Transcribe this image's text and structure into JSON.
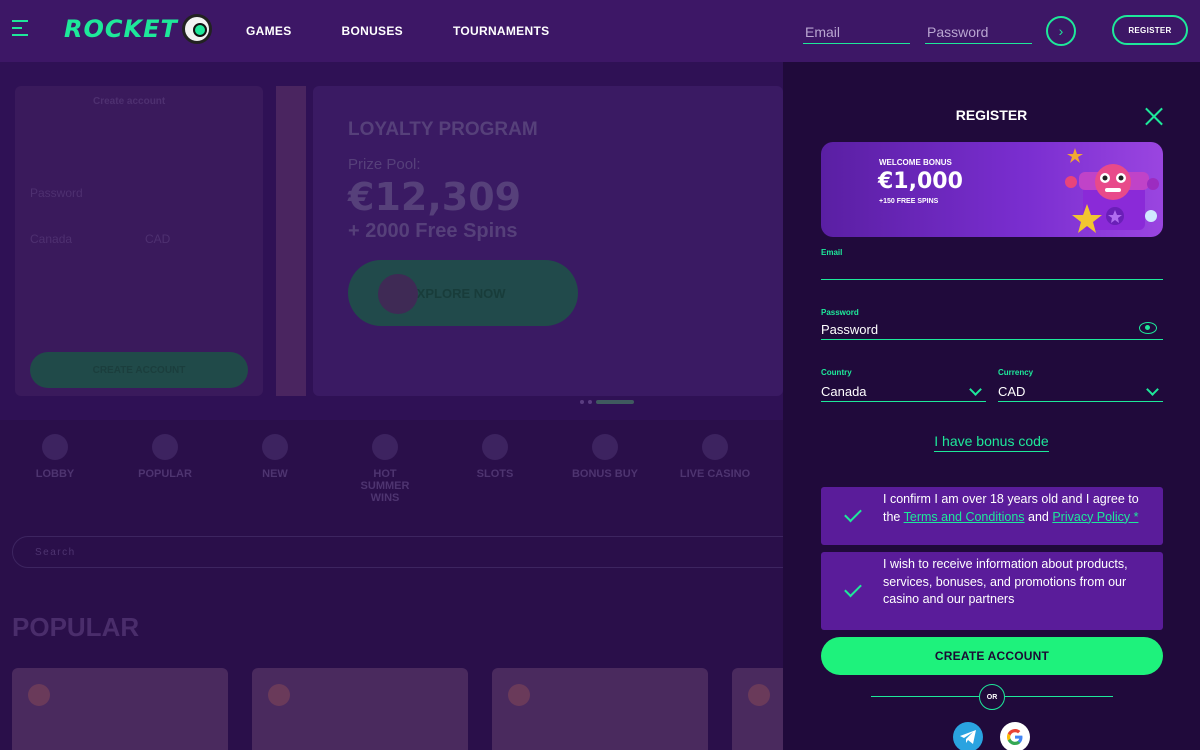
{
  "header": {
    "logo_text": "ROCKET",
    "nav": [
      "GAMES",
      "BONUSES",
      "TOURNAMENTS"
    ],
    "email_placeholder": "Email",
    "password_placeholder": "Password",
    "register_label": "REGISTER"
  },
  "background": {
    "form_title": "Create account",
    "form_password": "Password",
    "form_country": "Canada",
    "form_currency": "CAD",
    "form_button": "CREATE ACCOUNT",
    "loyalty_title": "LOYALTY PROGRAM",
    "prize_label": "Prize Pool:",
    "prize_amount": "€12,309",
    "prize_spins": "+ 2000 Free Spins",
    "explore_label": "EXPLORE NOW",
    "categories": [
      "LOBBY",
      "POPULAR",
      "NEW",
      "HOT SUMMER WINS",
      "SLOTS",
      "BONUS BUY",
      "LIVE CASINO"
    ],
    "search_placeholder": "Search",
    "popular_title": "POPULAR"
  },
  "drawer": {
    "title": "REGISTER",
    "bonus": {
      "label": "WELCOME BONUS",
      "amount": "€1,000",
      "spins": "+150 FREE SPINS"
    },
    "email_label": "Email",
    "email_value": "",
    "password_label": "Password",
    "password_value": "Password",
    "country_label": "Country",
    "country_value": "Canada",
    "currency_label": "Currency",
    "currency_value": "CAD",
    "bonus_code_link": "I have bonus code",
    "confirm_text_1": "I confirm I am over 18 years old and I agree to the ",
    "confirm_link_terms": "Terms and Conditions",
    "confirm_and": " and ",
    "confirm_link_privacy": "Privacy Policy *",
    "marketing_text": "I wish to receive information about products, services, bonuses, and promotions from our casino and our partners",
    "create_button": "CREATE ACCOUNT",
    "or_label": "OR"
  },
  "colors": {
    "accent": "#1ee89a",
    "header_bg": "#3d1766",
    "drawer_bg": "#200a3b",
    "card_bg": "#5a1c9a",
    "cta_bg": "#1ef27c"
  },
  "icons": [
    "menu-icon",
    "rocket-mascot-icon",
    "arrow-right-icon",
    "close-icon",
    "eye-icon",
    "chevron-down-icon",
    "check-icon",
    "telegram-icon",
    "google-icon"
  ]
}
